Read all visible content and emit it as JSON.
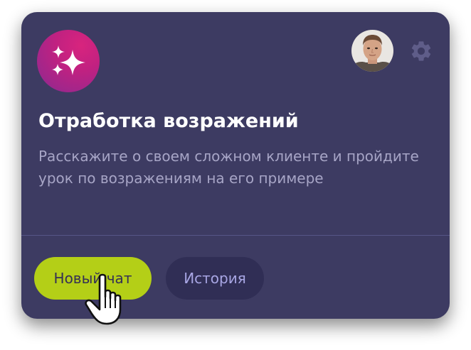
{
  "card": {
    "title": "Отработка возражений",
    "description": "Расскажите о своем сложном клиенте и пройдите урок по возражениям на его примере",
    "icon": "sparkles-icon",
    "settings_icon": "gear-icon"
  },
  "actions": {
    "new_chat_label": "Новый чат",
    "history_label": "История"
  },
  "colors": {
    "card_background": "#3d3b62",
    "badge_gradient_start": "#d8247e",
    "badge_gradient_end": "#8a2a92",
    "primary_button": "#b4cf17",
    "secondary_button": "#302e55",
    "secondary_button_text": "#a8a6e4",
    "description_text": "#a7a5c6"
  }
}
